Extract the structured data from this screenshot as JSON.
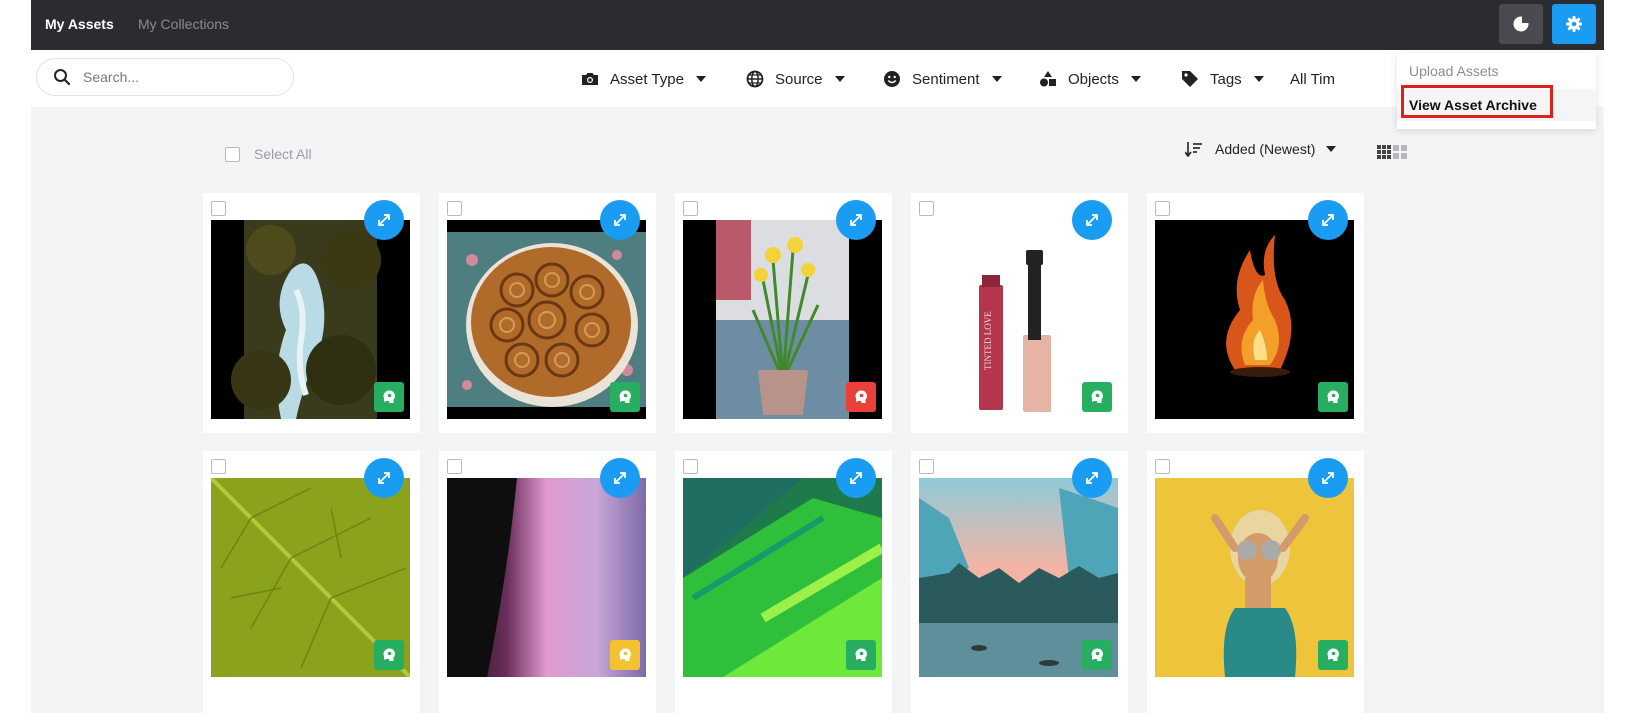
{
  "nav": {
    "tabs": [
      {
        "label": "My Assets"
      },
      {
        "label": "My Collections"
      }
    ]
  },
  "colors": {
    "accent": "#1a9cf2",
    "topbar": "#2b2c30",
    "positive": "#27ae60",
    "negative": "#e8413a",
    "neutral": "#f2c230",
    "highlight": "#e0201b"
  },
  "search": {
    "placeholder": "Search..."
  },
  "filters": [
    {
      "label": "Asset Type",
      "icon": "camera-icon"
    },
    {
      "label": "Source",
      "icon": "globe-icon"
    },
    {
      "label": "Sentiment",
      "icon": "smiley-icon"
    },
    {
      "label": "Objects",
      "icon": "shapes-icon"
    },
    {
      "label": "Tags",
      "icon": "tag-icon"
    },
    {
      "label": "All Tim",
      "icon": ""
    }
  ],
  "settings_menu": {
    "items": [
      {
        "label": "Upload Assets"
      },
      {
        "label": "View Asset Archive",
        "highlighted": true
      }
    ]
  },
  "toolbar": {
    "select_all": "Select All",
    "sort": "Added (Newest)",
    "view_icons": [
      "grid-view-icon",
      "tiles-view-icon"
    ]
  },
  "assets": [
    {
      "subject": "forest waterfall",
      "sentiment": "positive"
    },
    {
      "subject": "cinnamon bun cake",
      "sentiment": "positive"
    },
    {
      "subject": "daffodils in pot",
      "sentiment": "negative"
    },
    {
      "subject": "lip gloss",
      "product_text": "TINTED LOVE",
      "sentiment": "positive"
    },
    {
      "subject": "fire",
      "sentiment": "positive"
    },
    {
      "subject": "green leaf",
      "sentiment": "positive"
    },
    {
      "subject": "pink purple gradient",
      "sentiment": "neutral"
    },
    {
      "subject": "green abstract paint",
      "sentiment": "positive"
    },
    {
      "subject": "mountain lake",
      "sentiment": "positive"
    },
    {
      "subject": "woman with glasses",
      "sentiment": "positive"
    }
  ]
}
